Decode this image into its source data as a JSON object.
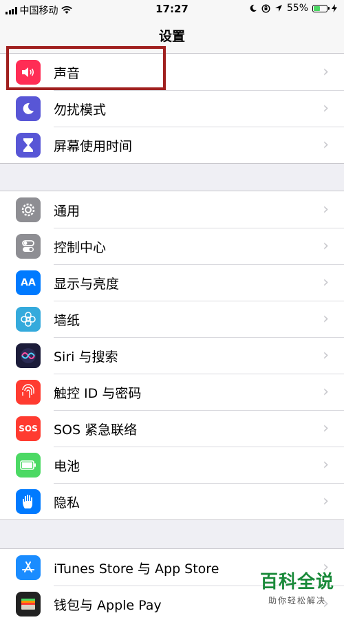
{
  "status_bar": {
    "carrier": "中国移动",
    "time": "17:27",
    "battery_percent": "55%",
    "battery_level": 0.55
  },
  "nav": {
    "title": "设置"
  },
  "groups": [
    [
      {
        "label": "声音",
        "icon": "speaker-icon",
        "color": "#ff2d55"
      },
      {
        "label": "勿扰模式",
        "icon": "moon-icon",
        "color": "#5856d6"
      },
      {
        "label": "屏幕使用时间",
        "icon": "hourglass-icon",
        "color": "#5856d6"
      }
    ],
    [
      {
        "label": "通用",
        "icon": "gear-icon",
        "color": "#8e8e93"
      },
      {
        "label": "控制中心",
        "icon": "toggle-icon",
        "color": "#8e8e93"
      },
      {
        "label": "显示与亮度",
        "icon": "text-size-icon",
        "color": "#007aff",
        "glyph": "AA"
      },
      {
        "label": "墙纸",
        "icon": "flower-icon",
        "color": "#34aadc"
      },
      {
        "label": "Siri 与搜索",
        "icon": "siri-icon",
        "color": "#1c1c3a"
      },
      {
        "label": "触控 ID 与密码",
        "icon": "fingerprint-icon",
        "color": "#ff3b30"
      },
      {
        "label": "SOS 紧急联络",
        "icon": "sos-icon",
        "color": "#ff3b30",
        "glyph": "SOS"
      },
      {
        "label": "电池",
        "icon": "battery-icon",
        "color": "#4cd964"
      },
      {
        "label": "隐私",
        "icon": "hand-icon",
        "color": "#007aff"
      }
    ],
    [
      {
        "label": "iTunes Store 与 App Store",
        "icon": "app-store-icon",
        "color": "#1a8cff"
      },
      {
        "label": "钱包与 Apple Pay",
        "icon": "wallet-icon",
        "color": "#222"
      }
    ]
  ],
  "watermark": {
    "main": "百科全说",
    "sub": "助你轻松解决"
  }
}
